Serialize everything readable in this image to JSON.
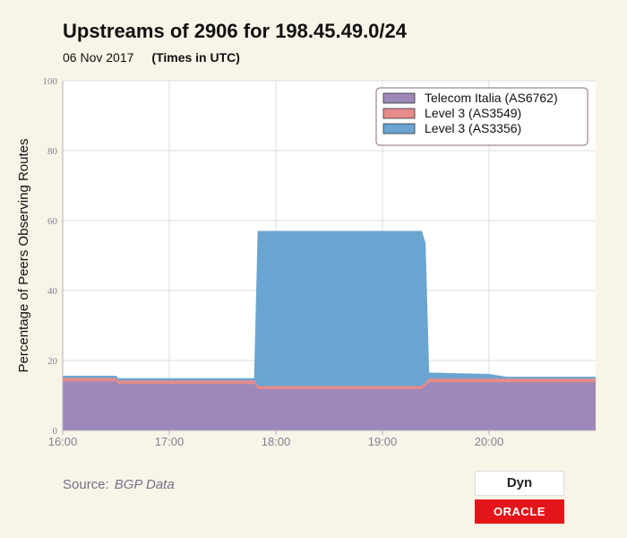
{
  "header": {
    "title": "Upstreams of 2906 for 198.45.49.0/24",
    "date": "06 Nov 2017",
    "timezone": "(Times in UTC)"
  },
  "footer": {
    "source_label": "Source:",
    "source_value": "BGP Data",
    "logo_dyn": "Dyn",
    "logo_oracle": "ORACLE"
  },
  "colors": {
    "background": "#f8f4e7",
    "plot_background": "#ffffff",
    "grid": "#dddddd"
  },
  "chart_data": {
    "type": "area",
    "stacked": true,
    "title": "Upstreams of 2906 for 198.45.49.0/24",
    "subtitle": "06 Nov 2017",
    "ylabel": "Percentage of Peers Observing Routes",
    "xlabel": "",
    "xlim": [
      "16:00",
      "21:00"
    ],
    "ylim": [
      0,
      100
    ],
    "x_ticks": [
      "16:00",
      "17:00",
      "18:00",
      "19:00",
      "20:00"
    ],
    "y_ticks": [
      0,
      20,
      40,
      60,
      80,
      100
    ],
    "grid": true,
    "legend_position": "top-right",
    "x": [
      "16:00",
      "16:30",
      "16:31",
      "17:48",
      "17:50",
      "19:22",
      "19:24",
      "19:26",
      "20:00",
      "20:10",
      "21:00"
    ],
    "series": [
      {
        "name": "Telecom Italia (AS6762)",
        "color": "#9d88b9",
        "values": [
          14,
          14,
          13.3,
          13.3,
          11.8,
          11.8,
          12.6,
          13.8,
          13.8,
          13.8,
          13.8
        ]
      },
      {
        "name": "Level 3 (AS3549)",
        "color": "#e58b8b",
        "values": [
          1,
          1,
          1,
          1,
          0.9,
          0.9,
          0.9,
          1,
          1,
          1,
          1
        ]
      },
      {
        "name": "Level 3 (AS3356)",
        "color": "#6aa4d1",
        "values": [
          0.5,
          0.5,
          0.5,
          0.5,
          44.2,
          44.2,
          40,
          1.6,
          1.2,
          0.4,
          0.4
        ]
      }
    ]
  }
}
